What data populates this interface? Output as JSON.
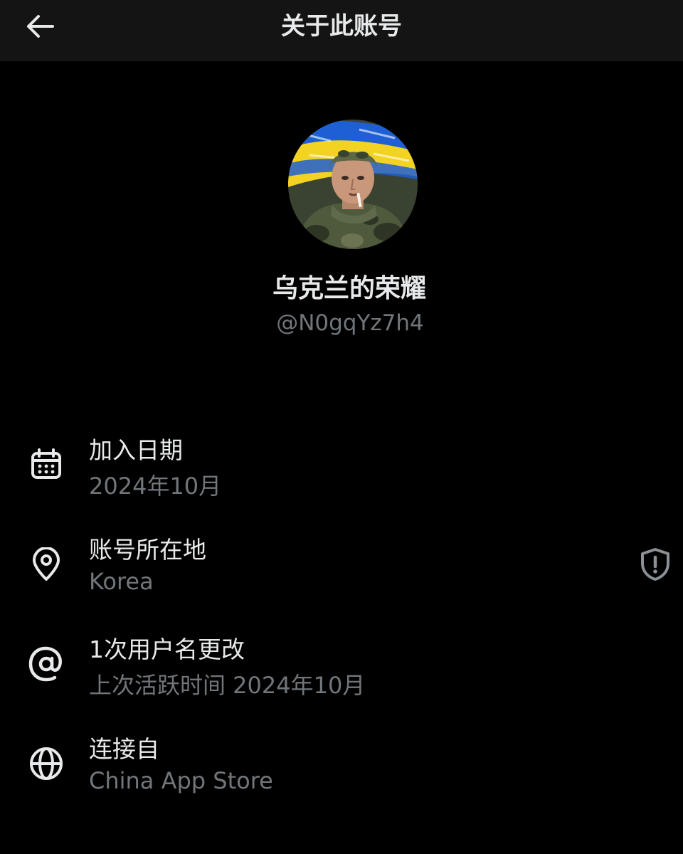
{
  "header": {
    "title": "关于此账号",
    "back_icon": "arrow-left-icon"
  },
  "profile": {
    "display_name": "乌克兰的荣耀",
    "handle": "@N0gqYz7h4",
    "avatar": "avatar-soldier-ukrainian-flag"
  },
  "details": [
    {
      "icon": "calendar-icon",
      "title": "加入日期",
      "value": "2024年10月"
    },
    {
      "icon": "location-pin-icon",
      "title": "账号所在地",
      "value": "Korea",
      "trailing_icon": "shield-exclamation-icon"
    },
    {
      "icon": "at-sign-icon",
      "title": "1次用户名更改",
      "value": "上次活跃时间 2024年10月"
    },
    {
      "icon": "globe-icon",
      "title": "连接自",
      "value": "China App Store"
    }
  ],
  "colors": {
    "background": "#000000",
    "header_background": "#141414",
    "primary_text": "#e7e9ea",
    "secondary_text": "#71767b",
    "flag_blue": "#1f5fd6",
    "flag_yellow": "#f3d322"
  }
}
